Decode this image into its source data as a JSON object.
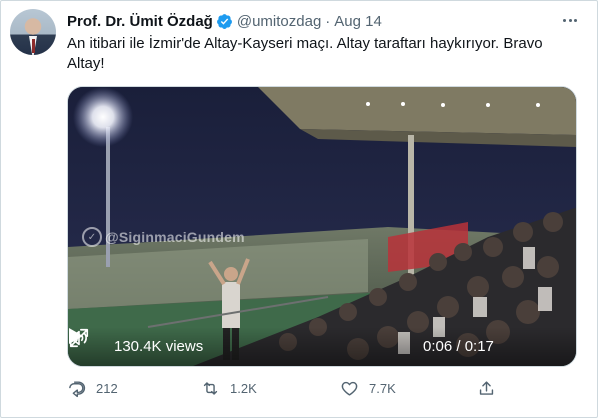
{
  "tweet": {
    "author_name": "Prof. Dr. Ümit Özdağ",
    "handle": "@umitozdag",
    "separator": "·",
    "date": "Aug 14",
    "text": "An itibari ile İzmir'de Altay-Kayseri maçı. Altay taraftarı haykırıyor. Bravo Altay!",
    "verified_color": "#1d9bf0",
    "icons": {
      "verified": "verified-badge-icon",
      "more": "more-options-icon",
      "play": "play-icon",
      "volume": "volume-icon",
      "fullscreen": "fullscreen-icon",
      "reply": "reply-icon",
      "retweet": "retweet-icon",
      "like": "heart-icon",
      "share": "share-icon"
    }
  },
  "video": {
    "watermark": "@SiginmaciGundem",
    "views": "130.4K views",
    "time": "0:06 / 0:17"
  },
  "actions": {
    "replies": "212",
    "retweets": "1.2K",
    "likes": "7.7K"
  }
}
